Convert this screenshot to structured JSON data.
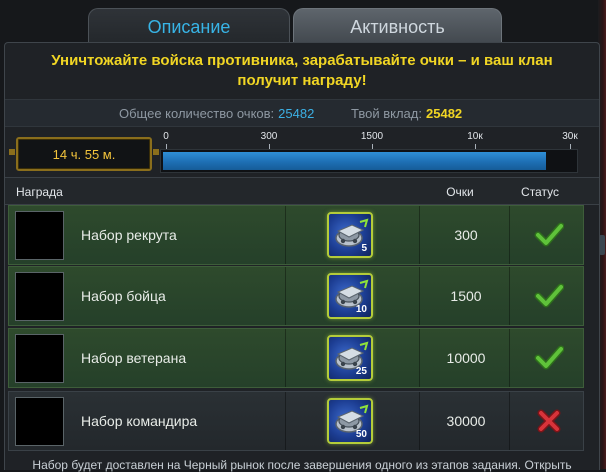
{
  "tabs": [
    {
      "label": "Описание",
      "active": true
    },
    {
      "label": "Активность",
      "active": false
    }
  ],
  "headline": {
    "line1": "Уничтожайте войска противника, зарабатывайте очки – и ваш клан",
    "line2": "получит награду!"
  },
  "stats": {
    "total_label": "Общее количество очков:",
    "total_value": "25482",
    "mine_label": "Твой вклад:",
    "mine_value": "25482"
  },
  "timer": "14 ч. 55 м.",
  "progress": {
    "ticks": [
      "0",
      "300",
      "1500",
      "10к",
      "30к"
    ],
    "fill_fraction": 0.93
  },
  "table": {
    "headers": {
      "reward": "Награда",
      "points": "Очки",
      "status": "Статус"
    },
    "rows": [
      {
        "name": "Набор рекрута",
        "count": "5",
        "points": "300",
        "status": "done"
      },
      {
        "name": "Набор бойца",
        "count": "10",
        "points": "1500",
        "status": "done"
      },
      {
        "name": "Набор ветерана",
        "count": "25",
        "points": "10000",
        "status": "done"
      },
      {
        "name": "Набор командира",
        "count": "50",
        "points": "30000",
        "status": "pending"
      }
    ]
  },
  "footer": "Набор будет доставлен на Черный рынок после завершения одного из этапов задания. Открыть",
  "colors": {
    "accent_blue": "#38b4e6",
    "headline_yellow": "#f1d624",
    "row_green": "#2e4a2c",
    "check_green": "#5fc23a",
    "cross_red": "#d8333a"
  }
}
